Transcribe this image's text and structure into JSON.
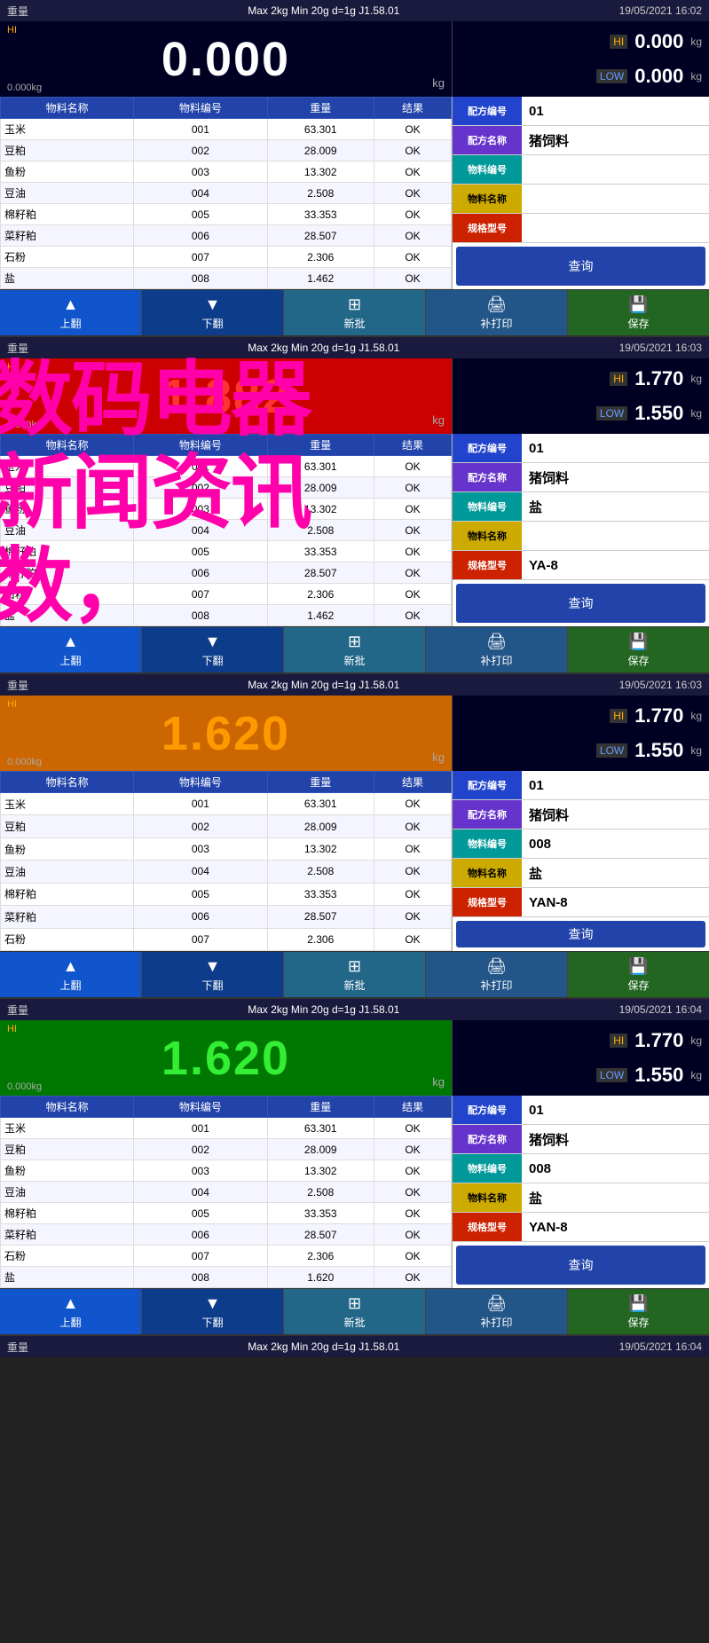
{
  "panels": [
    {
      "id": "panel1",
      "topbar": {
        "left": "重量",
        "center": "Max 2kg  Min 20g  d=1g    J1.58.01",
        "right": "19/05/2021  16:02"
      },
      "display": {
        "label": "HI",
        "weight": "0.000",
        "unit": "kg",
        "zero": "0.000kg",
        "hi_value": "0.000",
        "hi_unit": "kg",
        "low_label": "LOW",
        "low_value": "0.000",
        "low_unit": "kg",
        "bg": "normal"
      },
      "table": {
        "headers": [
          "物料名称",
          "物料编号",
          "重量",
          "结果"
        ],
        "rows": [
          [
            "玉米",
            "001",
            "63.301",
            "OK"
          ],
          [
            "豆粕",
            "002",
            "28.009",
            "OK"
          ],
          [
            "鱼粉",
            "003",
            "13.302",
            "OK"
          ],
          [
            "豆油",
            "004",
            "2.508",
            "OK"
          ],
          [
            "棉籽粕",
            "005",
            "33.353",
            "OK"
          ],
          [
            "菜籽粕",
            "006",
            "28.507",
            "OK"
          ],
          [
            "石粉",
            "007",
            "2.306",
            "OK"
          ],
          [
            "盐",
            "008",
            "1.462",
            "OK"
          ]
        ]
      },
      "info": {
        "formula_num_label": "配方编号",
        "formula_num": "01",
        "formula_name_label": "配方名称",
        "formula_name": "猪饲料",
        "material_num_label": "物料编号",
        "material_num": "",
        "material_name_label": "物料名称",
        "material_name": "",
        "spec_label": "规格型号",
        "spec": "",
        "query": "查询"
      },
      "buttons": [
        {
          "label": "上翻",
          "icon": "▲"
        },
        {
          "label": "下翻",
          "icon": "▼"
        },
        {
          "label": "新批",
          "icon": "⊞"
        },
        {
          "label": "补打印",
          "icon": "🖨"
        },
        {
          "label": "保存",
          "icon": "💾"
        }
      ]
    },
    {
      "id": "panel2",
      "topbar": {
        "left": "重量",
        "center": "Max 2kg  Min 20g  d=1g    J1.58.01",
        "right": "19/05/2021  16:03"
      },
      "display": {
        "label": "HI",
        "weight": "1.882",
        "unit": "kg",
        "zero": "0.000kg",
        "hi_value": "1.770",
        "hi_unit": "kg",
        "low_label": "LOW",
        "low_value": "1.550",
        "low_unit": "kg",
        "bg": "red"
      },
      "table": {
        "headers": [
          "物料名称",
          "物料编号",
          "重量",
          "结果"
        ],
        "rows": [
          [
            "玉米",
            "001",
            "63.301",
            "OK"
          ],
          [
            "豆粕",
            "002",
            "28.009",
            "OK"
          ],
          [
            "鱼粉",
            "003",
            "13.302",
            "OK"
          ],
          [
            "豆油",
            "004",
            "2.508",
            "OK"
          ],
          [
            "棉籽粕",
            "005",
            "33.353",
            "OK"
          ],
          [
            "菜籽粕",
            "006",
            "28.507",
            "OK"
          ],
          [
            "石粉",
            "007",
            "2.306",
            "OK"
          ],
          [
            "盐",
            "008",
            "1.462",
            "OK"
          ]
        ]
      },
      "info": {
        "formula_num_label": "配方编号",
        "formula_num": "01",
        "formula_name_label": "配方名称",
        "formula_name": "猪饲料",
        "material_num_label": "物料编号",
        "material_num": "盐",
        "material_name_label": "物料名称",
        "material_name": "",
        "spec_label": "规格型号",
        "spec": "YA-8",
        "query": "查询"
      },
      "buttons": [
        {
          "label": "上翻",
          "icon": "▲"
        },
        {
          "label": "下翻",
          "icon": "▼"
        },
        {
          "label": "新批",
          "icon": "⊞"
        },
        {
          "label": "补打印",
          "icon": "🖨"
        },
        {
          "label": "保存",
          "icon": "💾"
        }
      ]
    },
    {
      "id": "panel3",
      "topbar": {
        "left": "重量",
        "center": "Max 2kg  Min 20g  d=1g    J1.58.01",
        "right": "19/05/2021  16:03"
      },
      "display": {
        "label": "HI",
        "weight": "1.620",
        "unit": "kg",
        "zero": "0.000kg",
        "hi_value": "1.770",
        "hi_unit": "kg",
        "low_label": "LOW",
        "low_value": "1.550",
        "low_unit": "kg",
        "bg": "orange"
      },
      "table": {
        "headers": [
          "物料名称",
          "物料编号",
          "重量",
          "结果"
        ],
        "rows": [
          [
            "玉米",
            "001",
            "63.301",
            "OK"
          ],
          [
            "豆粕",
            "002",
            "28.009",
            "OK"
          ],
          [
            "鱼粉",
            "003",
            "13.302",
            "OK"
          ],
          [
            "豆油",
            "004",
            "2.508",
            "OK"
          ],
          [
            "棉籽粕",
            "005",
            "33.353",
            "OK"
          ],
          [
            "菜籽粕",
            "006",
            "28.507",
            "OK"
          ],
          [
            "石粉",
            "007",
            "2.306",
            "OK"
          ]
        ]
      },
      "info": {
        "formula_num_label": "配方编号",
        "formula_num": "01",
        "formula_name_label": "配方名称",
        "formula_name": "猪饲料",
        "material_num_label": "物料编号",
        "material_num": "008",
        "material_name_label": "物料名称",
        "material_name": "盐",
        "spec_label": "规格型号",
        "spec": "YAN-8",
        "query": "查询"
      },
      "buttons": [
        {
          "label": "上翻",
          "icon": "▲"
        },
        {
          "label": "下翻",
          "icon": "▼"
        },
        {
          "label": "新批",
          "icon": "⊞"
        },
        {
          "label": "补打印",
          "icon": "🖨"
        },
        {
          "label": "保存",
          "icon": "💾"
        }
      ]
    },
    {
      "id": "panel4",
      "topbar": {
        "left": "重量",
        "center": "Max 2kg  Min 20g  d=1g    J1.58.01",
        "right": "19/05/2021  16:04"
      },
      "display": {
        "label": "HI",
        "weight": "1.620",
        "unit": "kg",
        "zero": "0.000kg",
        "hi_value": "1.770",
        "hi_unit": "kg",
        "low_label": "LOW",
        "low_value": "1.550",
        "low_unit": "kg",
        "bg": "green"
      },
      "table": {
        "headers": [
          "物料名称",
          "物料编号",
          "重量",
          "结果"
        ],
        "rows": [
          [
            "玉米",
            "001",
            "63.301",
            "OK"
          ],
          [
            "豆粕",
            "002",
            "28.009",
            "OK"
          ],
          [
            "鱼粉",
            "003",
            "13.302",
            "OK"
          ],
          [
            "豆油",
            "004",
            "2.508",
            "OK"
          ],
          [
            "棉籽粕",
            "005",
            "33.353",
            "OK"
          ],
          [
            "菜籽粕",
            "006",
            "28.507",
            "OK"
          ],
          [
            "石粉",
            "007",
            "2.306",
            "OK"
          ],
          [
            "盐",
            "008",
            "1.620",
            "OK"
          ]
        ]
      },
      "info": {
        "formula_num_label": "配方编号",
        "formula_num": "01",
        "formula_name_label": "配方名称",
        "formula_name": "猪饲料",
        "material_num_label": "物料编号",
        "material_num": "008",
        "material_name_label": "物料名称",
        "material_name": "盐",
        "spec_label": "规格型号",
        "spec": "YAN-8",
        "query": "查询"
      },
      "buttons": [
        {
          "label": "上翻",
          "icon": "▲"
        },
        {
          "label": "下翻",
          "icon": "▼"
        },
        {
          "label": "新批",
          "icon": "⊞"
        },
        {
          "label": "补打印",
          "icon": "🖨"
        },
        {
          "label": "保存",
          "icon": "💾"
        }
      ]
    }
  ],
  "watermark": {
    "line1": "数码电器",
    "line2": "新闻资讯",
    "line3": "数，"
  },
  "footer": {
    "topbar": {
      "left": "重量",
      "center": "Max 2kg  Min 20g  d=1g    J1.58.01",
      "right": "19/05/2021  16:04"
    }
  }
}
